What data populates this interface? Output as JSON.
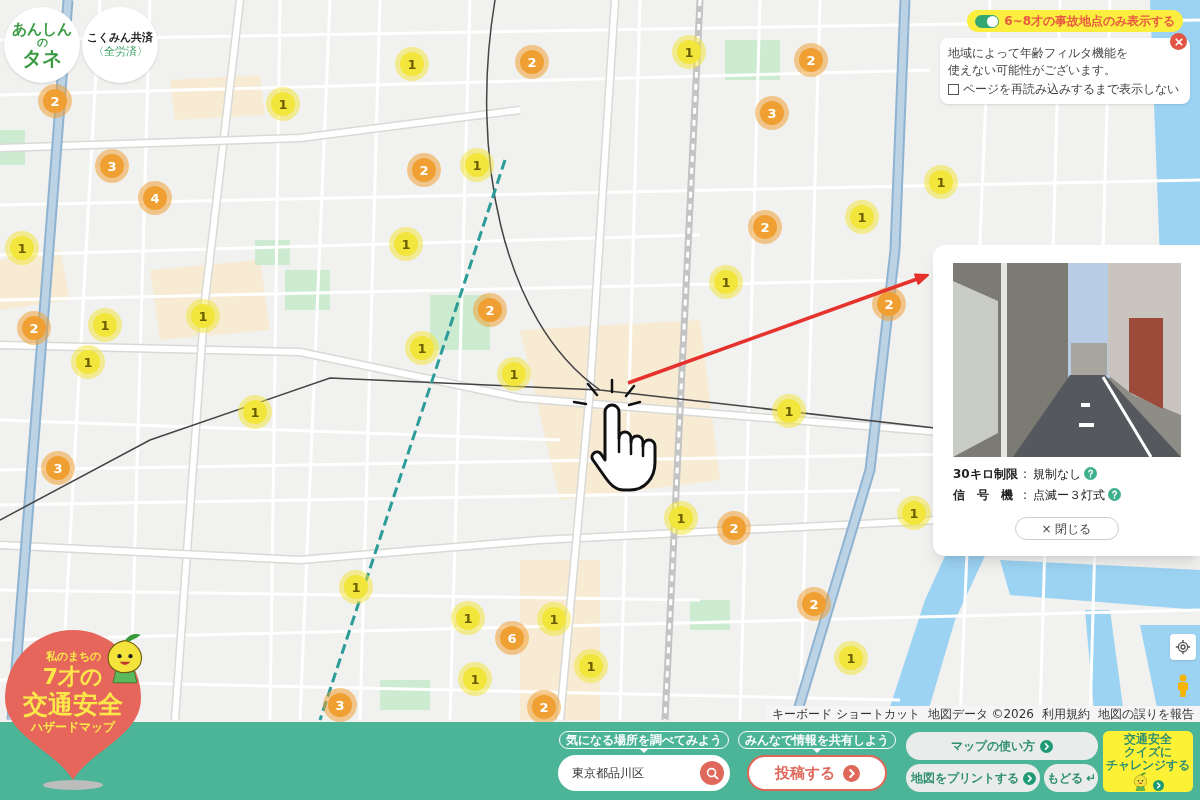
{
  "map": {
    "markers": [
      {
        "count": "1",
        "color": "#f2e53c"
      },
      {
        "count": "2",
        "color": "#f0a032"
      },
      {
        "count": "2",
        "color": "#f0a032"
      },
      {
        "count": "1",
        "color": "#f2e53c"
      },
      {
        "count": "2",
        "color": "#f0a032"
      },
      {
        "count": "1",
        "color": "#f2e53c"
      },
      {
        "count": "3",
        "color": "#f0a032"
      },
      {
        "count": "3",
        "color": "#f0a032"
      },
      {
        "count": "2",
        "color": "#f0a032"
      },
      {
        "count": "1",
        "color": "#f2e53c"
      },
      {
        "count": "4",
        "color": "#f0a032"
      },
      {
        "count": "1",
        "color": "#f2e53c"
      },
      {
        "count": "2",
        "color": "#f0a032"
      },
      {
        "count": "1",
        "color": "#f2e53c"
      },
      {
        "count": "1",
        "color": "#f2e53c"
      },
      {
        "count": "1",
        "color": "#f2e53c"
      },
      {
        "count": "1",
        "color": "#f2e53c"
      },
      {
        "count": "2",
        "color": "#f0a032"
      },
      {
        "count": "2",
        "color": "#f0a032"
      },
      {
        "count": "1",
        "color": "#f2e53c"
      },
      {
        "count": "1",
        "color": "#f2e53c"
      },
      {
        "count": "2",
        "color": "#f0a032"
      },
      {
        "count": "1",
        "color": "#f2e53c"
      },
      {
        "count": "1",
        "color": "#f2e53c"
      },
      {
        "count": "1",
        "color": "#f2e53c"
      },
      {
        "count": "1",
        "color": "#f2e53c"
      },
      {
        "count": "1",
        "color": "#f2e53c"
      },
      {
        "count": "3",
        "color": "#f0a032"
      },
      {
        "count": "1",
        "color": "#f2e53c"
      },
      {
        "count": "2",
        "color": "#f0a032"
      },
      {
        "count": "1",
        "color": "#f2e53c"
      },
      {
        "count": "1",
        "color": "#f2e53c"
      },
      {
        "count": "2",
        "color": "#f0a032"
      },
      {
        "count": "1",
        "color": "#f2e53c"
      },
      {
        "count": "1",
        "color": "#f2e53c"
      },
      {
        "count": "6",
        "color": "#f0a032"
      },
      {
        "count": "1",
        "color": "#f2e53c"
      },
      {
        "count": "1",
        "color": "#f2e53c"
      },
      {
        "count": "1",
        "color": "#f2e53c"
      },
      {
        "count": "3",
        "color": "#f0a032"
      },
      {
        "count": "2",
        "color": "#f0a032"
      }
    ],
    "attribution": [
      "キーボード ショートカット",
      "地図データ ©2026",
      "利用規約",
      "地図の誤りを報告"
    ]
  },
  "logos": {
    "anshin": [
      "あんしん",
      "の",
      "タネ"
    ],
    "kokumin": [
      "こくみん共済",
      "〈全労済〉"
    ]
  },
  "title_logo": [
    "私のまちの",
    "7才の",
    "交通安全",
    "ハザードマップ"
  ],
  "age_filter": {
    "label": "6~8才の事故地点のみ表示する",
    "on": true
  },
  "notice": {
    "message": "地域によって年齢フィルタ機能を使えない可能性がございます。",
    "dont_show": {
      "label": "ページを再読み込みするまで表示しない",
      "checked": false
    }
  },
  "spot_popup": {
    "rows": [
      {
        "label": "30キロ制限",
        "separator": ":",
        "value": "規制なし"
      },
      {
        "label": "信　号　機",
        "separator": ":",
        "value": "点滅ー３灯式"
      }
    ],
    "close_button": "× 閉じる"
  },
  "bottom_bar": {
    "search": {
      "caption": "気になる場所を調べてみよう",
      "value": "東京都品川区"
    },
    "post": {
      "caption": "みんなで情報を共有しよう",
      "label": "投稿する"
    },
    "guide_button": "マップの使い方",
    "print_button": "地図をプリントする",
    "back_button": "もどる",
    "quiz_button": [
      "交通安全",
      "クイズに",
      "チャレンジする"
    ]
  }
}
